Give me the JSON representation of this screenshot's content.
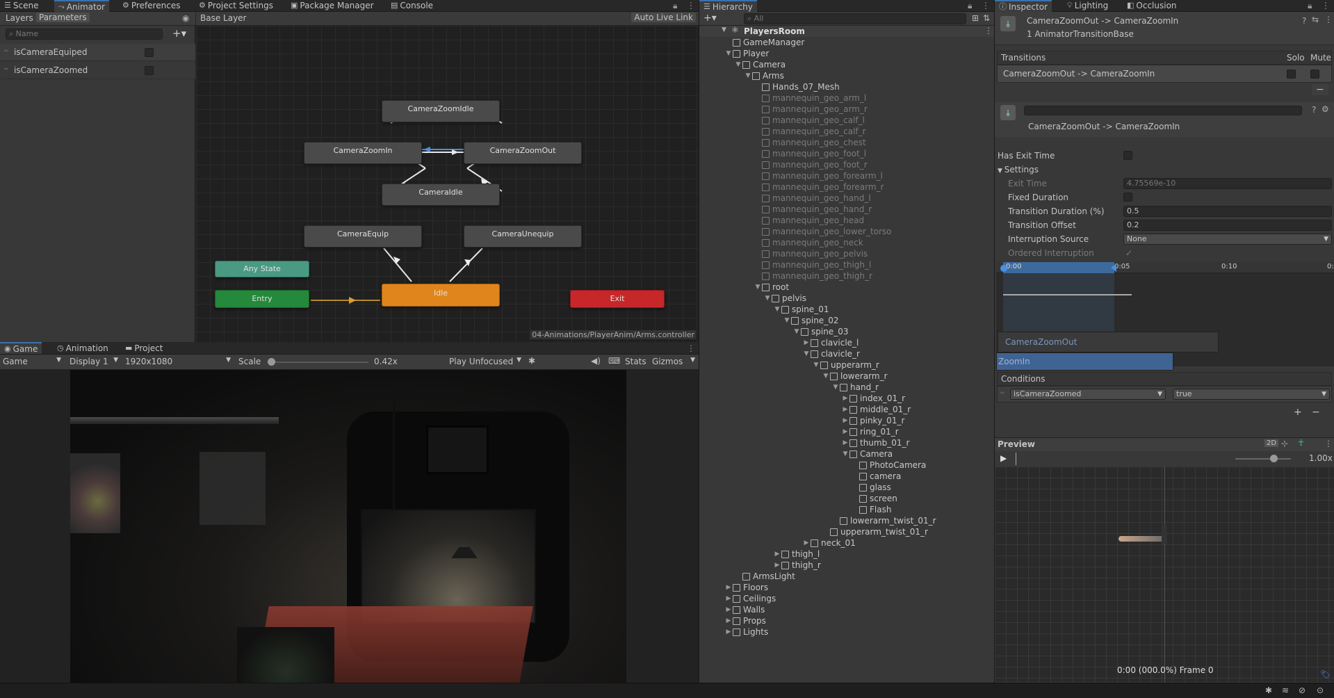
{
  "tabs_left": {
    "scene": "Scene",
    "animator": "Animator",
    "preferences": "Preferences",
    "project_settings": "Project Settings",
    "package_manager": "Package Manager",
    "console": "Console"
  },
  "animator": {
    "layers_tab": "Layers",
    "parameters_tab": "Parameters",
    "search_placeholder": "Name",
    "params": [
      {
        "name": "isCameraEquiped"
      },
      {
        "name": "isCameraZoomed"
      }
    ],
    "layer_name": "Base Layer",
    "auto_live_link": "Auto Live Link",
    "footer_path": "04-Animations/PlayerAnim/Arms.controller",
    "states": {
      "zoom_idle": "CameraZoomIdle",
      "zoom_in": "CameraZoomIn",
      "zoom_out": "CameraZoomOut",
      "camera_idle": "CameraIdle",
      "equip": "CameraEquip",
      "unequip": "CameraUnequip",
      "any_state": "Any State",
      "entry": "Entry",
      "idle": "Idle",
      "exit": "Exit"
    }
  },
  "game": {
    "tabs": {
      "game": "Game",
      "animation": "Animation",
      "project": "Project"
    },
    "display_mode": "Game",
    "display": "Display 1",
    "resolution": "1920x1080",
    "scale_label": "Scale",
    "scale_value": "0.42x",
    "play_mode": "Play Unfocused",
    "stats": "Stats",
    "gizmos": "Gizmos"
  },
  "hierarchy": {
    "title": "Hierarchy",
    "search_placeholder": "All",
    "root": "PlayersRoom",
    "rows": [
      {
        "label": "GameManager",
        "depth": 1,
        "arrow": "",
        "dim": false
      },
      {
        "label": "Player",
        "depth": 1,
        "arrow": "▼",
        "dim": false
      },
      {
        "label": "Camera",
        "depth": 2,
        "arrow": "▼",
        "dim": false
      },
      {
        "label": "Arms",
        "depth": 3,
        "arrow": "▼",
        "dim": false
      },
      {
        "label": "Hands_07_Mesh",
        "depth": 4,
        "arrow": "",
        "dim": false
      },
      {
        "label": "mannequin_geo_arm_l",
        "depth": 4,
        "arrow": "",
        "dim": true
      },
      {
        "label": "mannequin_geo_arm_r",
        "depth": 4,
        "arrow": "",
        "dim": true
      },
      {
        "label": "mannequin_geo_calf_l",
        "depth": 4,
        "arrow": "",
        "dim": true
      },
      {
        "label": "mannequin_geo_calf_r",
        "depth": 4,
        "arrow": "",
        "dim": true
      },
      {
        "label": "mannequin_geo_chest",
        "depth": 4,
        "arrow": "",
        "dim": true
      },
      {
        "label": "mannequin_geo_foot_l",
        "depth": 4,
        "arrow": "",
        "dim": true
      },
      {
        "label": "mannequin_geo_foot_r",
        "depth": 4,
        "arrow": "",
        "dim": true
      },
      {
        "label": "mannequin_geo_forearm_l",
        "depth": 4,
        "arrow": "",
        "dim": true
      },
      {
        "label": "mannequin_geo_forearm_r",
        "depth": 4,
        "arrow": "",
        "dim": true
      },
      {
        "label": "mannequin_geo_hand_l",
        "depth": 4,
        "arrow": "",
        "dim": true
      },
      {
        "label": "mannequin_geo_hand_r",
        "depth": 4,
        "arrow": "",
        "dim": true
      },
      {
        "label": "mannequin_geo_head",
        "depth": 4,
        "arrow": "",
        "dim": true
      },
      {
        "label": "mannequin_geo_lower_torso",
        "depth": 4,
        "arrow": "",
        "dim": true
      },
      {
        "label": "mannequin_geo_neck",
        "depth": 4,
        "arrow": "",
        "dim": true
      },
      {
        "label": "mannequin_geo_pelvis",
        "depth": 4,
        "arrow": "",
        "dim": true
      },
      {
        "label": "mannequin_geo_thigh_l",
        "depth": 4,
        "arrow": "",
        "dim": true
      },
      {
        "label": "mannequin_geo_thigh_r",
        "depth": 4,
        "arrow": "",
        "dim": true
      },
      {
        "label": "root",
        "depth": 4,
        "arrow": "▼",
        "dim": false
      },
      {
        "label": "pelvis",
        "depth": 5,
        "arrow": "▼",
        "dim": false
      },
      {
        "label": "spine_01",
        "depth": 6,
        "arrow": "▼",
        "dim": false
      },
      {
        "label": "spine_02",
        "depth": 7,
        "arrow": "▼",
        "dim": false
      },
      {
        "label": "spine_03",
        "depth": 8,
        "arrow": "▼",
        "dim": false
      },
      {
        "label": "clavicle_l",
        "depth": 9,
        "arrow": "▶",
        "dim": false
      },
      {
        "label": "clavicle_r",
        "depth": 9,
        "arrow": "▼",
        "dim": false
      },
      {
        "label": "upperarm_r",
        "depth": 10,
        "arrow": "▼",
        "dim": false
      },
      {
        "label": "lowerarm_r",
        "depth": 11,
        "arrow": "▼",
        "dim": false
      },
      {
        "label": "hand_r",
        "depth": 12,
        "arrow": "▼",
        "dim": false
      },
      {
        "label": "index_01_r",
        "depth": 13,
        "arrow": "▶",
        "dim": false
      },
      {
        "label": "middle_01_r",
        "depth": 13,
        "arrow": "▶",
        "dim": false
      },
      {
        "label": "pinky_01_r",
        "depth": 13,
        "arrow": "▶",
        "dim": false
      },
      {
        "label": "ring_01_r",
        "depth": 13,
        "arrow": "▶",
        "dim": false
      },
      {
        "label": "thumb_01_r",
        "depth": 13,
        "arrow": "▶",
        "dim": false
      },
      {
        "label": "Camera",
        "depth": 13,
        "arrow": "▼",
        "dim": false
      },
      {
        "label": "PhotoCamera",
        "depth": 14,
        "arrow": "",
        "dim": false
      },
      {
        "label": "camera",
        "depth": 14,
        "arrow": "",
        "dim": false
      },
      {
        "label": "glass",
        "depth": 14,
        "arrow": "",
        "dim": false
      },
      {
        "label": "screen",
        "depth": 14,
        "arrow": "",
        "dim": false
      },
      {
        "label": "Flash",
        "depth": 14,
        "arrow": "",
        "dim": false
      },
      {
        "label": "lowerarm_twist_01_r",
        "depth": 12,
        "arrow": "",
        "dim": false
      },
      {
        "label": "upperarm_twist_01_r",
        "depth": 11,
        "arrow": "",
        "dim": false
      },
      {
        "label": "neck_01",
        "depth": 9,
        "arrow": "▶",
        "dim": false
      },
      {
        "label": "thigh_l",
        "depth": 6,
        "arrow": "▶",
        "dim": false
      },
      {
        "label": "thigh_r",
        "depth": 6,
        "arrow": "▶",
        "dim": false
      },
      {
        "label": "ArmsLight",
        "depth": 2,
        "arrow": "",
        "dim": false
      },
      {
        "label": "Floors",
        "depth": 1,
        "arrow": "▶",
        "dim": false
      },
      {
        "label": "Ceilings",
        "depth": 1,
        "arrow": "▶",
        "dim": false
      },
      {
        "label": "Walls",
        "depth": 1,
        "arrow": "▶",
        "dim": false
      },
      {
        "label": "Props",
        "depth": 1,
        "arrow": "▶",
        "dim": false
      },
      {
        "label": "Lights",
        "depth": 1,
        "arrow": "▶",
        "dim": false
      }
    ]
  },
  "inspector": {
    "tabs": {
      "inspector": "Inspector",
      "lighting": "Lighting",
      "occlusion": "Occlusion"
    },
    "header_title": "CameraZoomOut -> CameraZoomIn",
    "header_sub": "1 AnimatorTransitionBase",
    "transitions_label": "Transitions",
    "solo": "Solo",
    "mute": "Mute",
    "transition_item": "CameraZoomOut -> CameraZoomIn",
    "transition_name": "CameraZoomOut -> CameraZoomIn",
    "has_exit_time": "Has Exit Time",
    "settings": "Settings",
    "exit_time_label": "Exit Time",
    "exit_time_value": "4.75569e-10",
    "fixed_duration": "Fixed Duration",
    "transition_duration_label": "Transition Duration (%)",
    "transition_duration_value": "0.5",
    "transition_offset_label": "Transition Offset",
    "transition_offset_value": "0.2",
    "interruption_source_label": "Interruption Source",
    "interruption_source_value": "None",
    "ordered_interruption": "Ordered Interruption",
    "timeline": {
      "t0": "0:00",
      "t1": "0:05",
      "t2": "0:10",
      "t3": "0:"
    },
    "clip_out": "CameraZoomOut",
    "clip_in": "ZoomIn",
    "conditions": "Conditions",
    "condition_param": "isCameraZoomed",
    "condition_value": "true",
    "preview": "Preview",
    "preview_2d": "2D",
    "preview_speed": "1.00x",
    "preview_status": "0:00 (000.0%) Frame 0"
  }
}
